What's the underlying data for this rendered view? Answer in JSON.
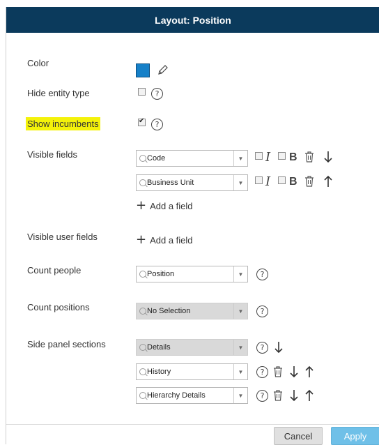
{
  "dialog": {
    "title": "Layout: Position"
  },
  "fields": {
    "color_label": "Color",
    "color_value": "#1680c8",
    "hide_entity_label": "Hide entity type",
    "hide_entity_checked": false,
    "show_incumbents_label": "Show incumbents",
    "show_incumbents_checked": true,
    "visible_fields_label": "Visible fields",
    "visible_fields": [
      {
        "value": "Code",
        "italic": false,
        "bold": false,
        "move": "down"
      },
      {
        "value": "Business Unit",
        "italic": false,
        "bold": false,
        "move": "up"
      }
    ],
    "add_field_label": "Add a field",
    "visible_user_fields_label": "Visible user fields",
    "count_people_label": "Count people",
    "count_people_value": "Position",
    "count_positions_label": "Count positions",
    "count_positions_value": "No Selection",
    "side_panel_label": "Side panel sections",
    "side_panel_sections": [
      {
        "value": "Details"
      },
      {
        "value": "History"
      },
      {
        "value": "Hierarchy Details"
      }
    ]
  },
  "icons": {
    "help": "?",
    "plus": "+",
    "italic": "I",
    "bold": "B",
    "dropdown": "▼"
  },
  "footer": {
    "cancel_label": "Cancel",
    "apply_label": "Apply"
  },
  "colors": {
    "titlebar": "#0b3a5c",
    "highlight": "#f4f20a",
    "apply": "#6fc0e8"
  }
}
